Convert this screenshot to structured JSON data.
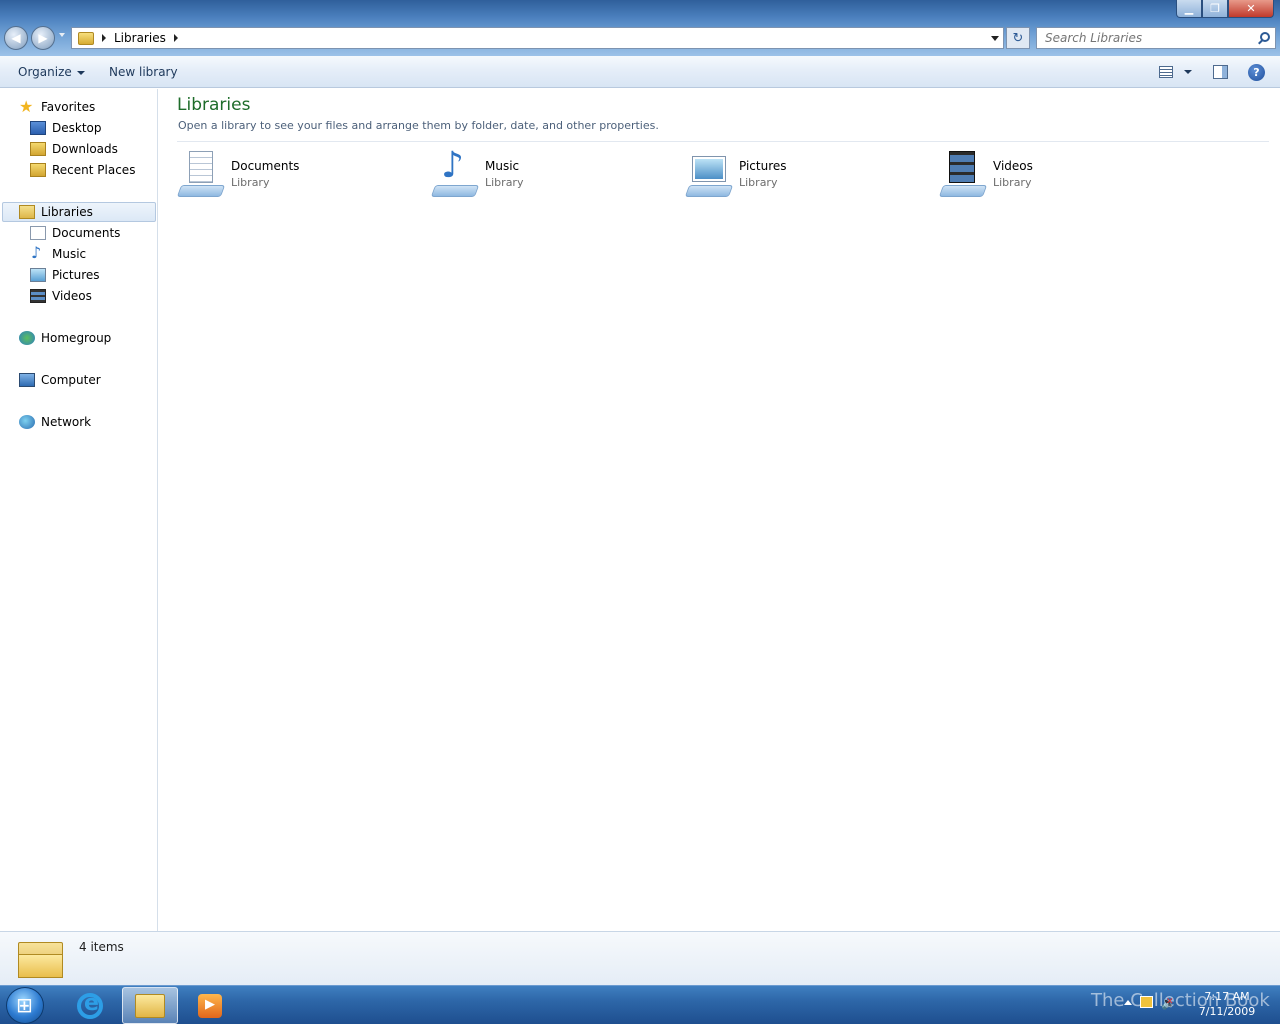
{
  "window": {
    "controls": {
      "minimize": "▁",
      "maximize": "❐",
      "close": "✕"
    }
  },
  "address": {
    "path": "Libraries",
    "refresh_glyph": "↻"
  },
  "search": {
    "placeholder": "Search Libraries"
  },
  "toolbar": {
    "organize_label": "Organize",
    "new_library_label": "New library",
    "help_glyph": "?"
  },
  "nav": {
    "favorites": {
      "label": "Favorites",
      "items": [
        {
          "label": "Desktop",
          "icon": "desktop-icon"
        },
        {
          "label": "Downloads",
          "icon": "downloads-icon"
        },
        {
          "label": "Recent Places",
          "icon": "recent-places-icon"
        }
      ]
    },
    "libraries": {
      "label": "Libraries",
      "items": [
        {
          "label": "Documents",
          "icon": "documents-icon"
        },
        {
          "label": "Music",
          "icon": "music-icon"
        },
        {
          "label": "Pictures",
          "icon": "pictures-icon"
        },
        {
          "label": "Videos",
          "icon": "videos-icon"
        }
      ]
    },
    "homegroup": {
      "label": "Homegroup"
    },
    "computer": {
      "label": "Computer"
    },
    "network": {
      "label": "Network"
    }
  },
  "main": {
    "title": "Libraries",
    "subtitle": "Open a library to see your files and arrange them by folder, date, and other properties.",
    "libraries": [
      {
        "name": "Documents",
        "type": "Library",
        "icon": "documents-library-icon"
      },
      {
        "name": "Music",
        "type": "Library",
        "icon": "music-library-icon"
      },
      {
        "name": "Pictures",
        "type": "Library",
        "icon": "pictures-library-icon"
      },
      {
        "name": "Videos",
        "type": "Library",
        "icon": "videos-library-icon"
      }
    ]
  },
  "details": {
    "count_text": "4 items"
  },
  "taskbar": {
    "watermark": "The Collection Book",
    "time": "7:17 AM",
    "date": "7/11/2009"
  }
}
